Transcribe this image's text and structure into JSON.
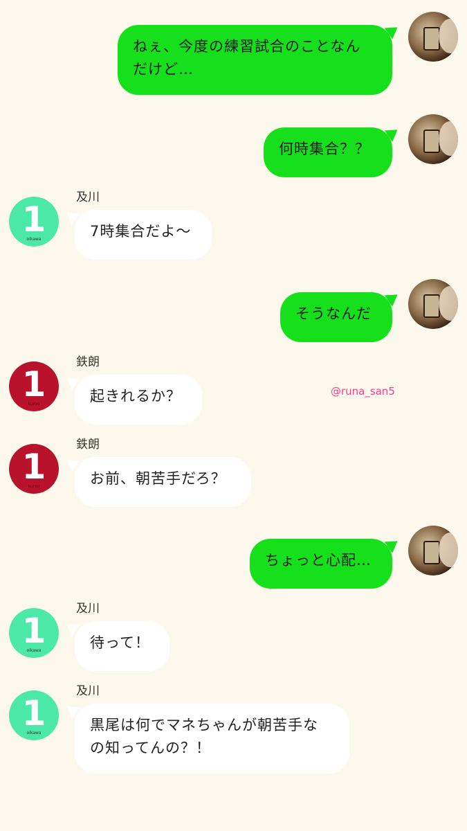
{
  "messages": [
    {
      "side": "me",
      "text": "ねぇ、今度の練習試合のことなんだけど…"
    },
    {
      "side": "me",
      "text": "何時集合？？"
    },
    {
      "side": "them",
      "sender": "及川",
      "avatar_number": "1",
      "avatar_tag": "oikawa",
      "avatar_color": "#4ce8a8",
      "text": "7時集合だよ〜"
    },
    {
      "side": "me",
      "text": "そうなんだ"
    },
    {
      "side": "them",
      "sender": "鉄朗",
      "avatar_number": "1",
      "avatar_tag": "kuroo",
      "avatar_color": "#b8122c",
      "text": "起きれるか？"
    },
    {
      "side": "them",
      "sender": "鉄朗",
      "avatar_number": "1",
      "avatar_tag": "kuroo",
      "avatar_color": "#b8122c",
      "text": "お前、朝苦手だろ？"
    },
    {
      "side": "me",
      "text": "ちょっと心配…"
    },
    {
      "side": "them",
      "sender": "及川",
      "avatar_number": "1",
      "avatar_tag": "oikawa",
      "avatar_color": "#4ce8a8",
      "text": "待って！"
    },
    {
      "side": "them",
      "sender": "及川",
      "avatar_number": "1",
      "avatar_tag": "oikawa",
      "avatar_color": "#4ce8a8",
      "text": "黒尾は何でマネちゃんが朝苦手なの知ってんの？！"
    }
  ],
  "message_lines": {
    "m0": [
      "ねぇ、今度の練習試合のことなん",
      "だけど…"
    ],
    "m8": [
      "黒尾は何でマネちゃんが朝苦手な",
      "の知ってんの？！"
    ]
  },
  "watermark": "@runa_san5",
  "colors": {
    "background": "#fdf8ec",
    "my_bubble": "#16e01c",
    "their_bubble": "#ffffff",
    "watermark": "#ff3a8c"
  }
}
